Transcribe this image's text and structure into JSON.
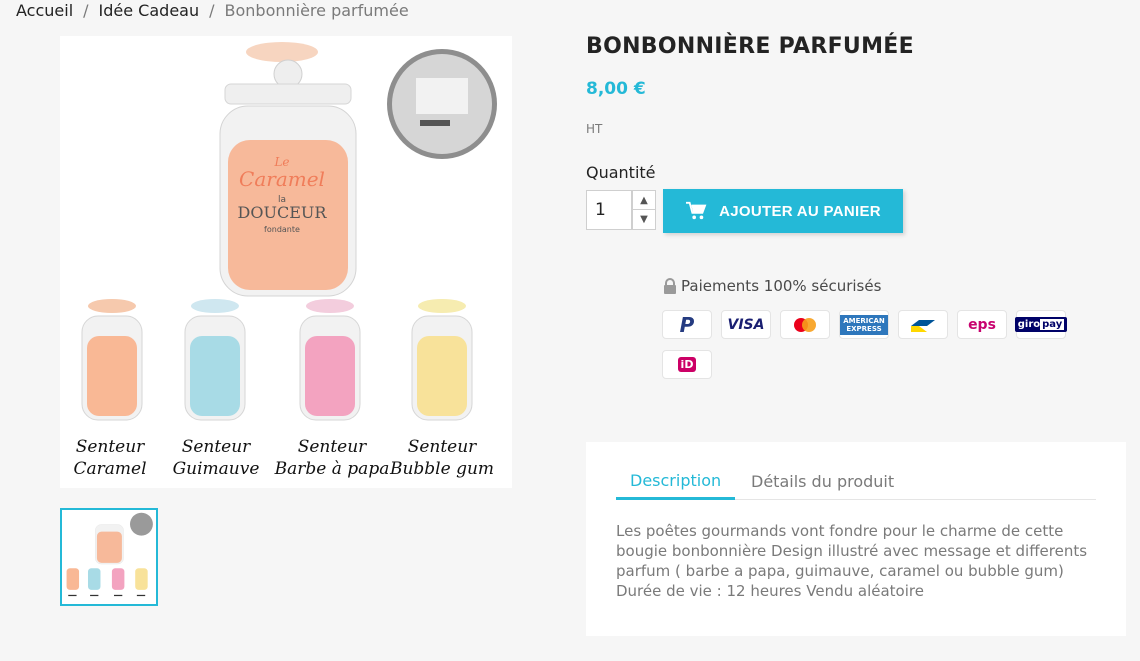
{
  "breadcrumb": {
    "items": [
      "Accueil",
      "Idée Cadeau",
      "Bonbonnière parfumée"
    ]
  },
  "product": {
    "title": "BONBONNIÈRE PARFUMÉE",
    "price": "8,00 €",
    "tax_label": "HT",
    "quantity_label": "Quantité",
    "quantity_value": "1",
    "add_to_cart_label": "AJOUTER AU PANIER",
    "image_labels": {
      "jar_main": [
        "Le",
        "Caramel",
        "la",
        "DOUCEUR",
        "fondante"
      ],
      "scents": [
        {
          "line1": "Senteur",
          "line2": "Caramel"
        },
        {
          "line1": "Senteur",
          "line2": "Guimauve"
        },
        {
          "line1": "Senteur",
          "line2": "Barbe à papa"
        },
        {
          "line1": "Senteur",
          "line2": "Bubble gum"
        }
      ]
    }
  },
  "reassurance": {
    "secure_payments": "Paiements 100% sécurisés",
    "payment_methods": [
      "PayPal",
      "VISA",
      "Mastercard",
      "AMERICAN EXPRESS",
      "Bancontact",
      "eps",
      "giropay",
      "iDEAL"
    ]
  },
  "tabs": {
    "description_label": "Description",
    "details_label": "Détails du produit",
    "description_text": "Les poêtes gourmands vont fondre pour le charme de cette bougie bonbonnière Design illustré avec message et differents parfum ( barbe a papa, guimauve, caramel ou bubble gum) Durée de vie : 12 heures Vendu aléatoire"
  },
  "colors": {
    "accent": "#24b9d7",
    "text": "#232323",
    "muted": "#7a7a7a",
    "background": "#f6f6f6"
  }
}
